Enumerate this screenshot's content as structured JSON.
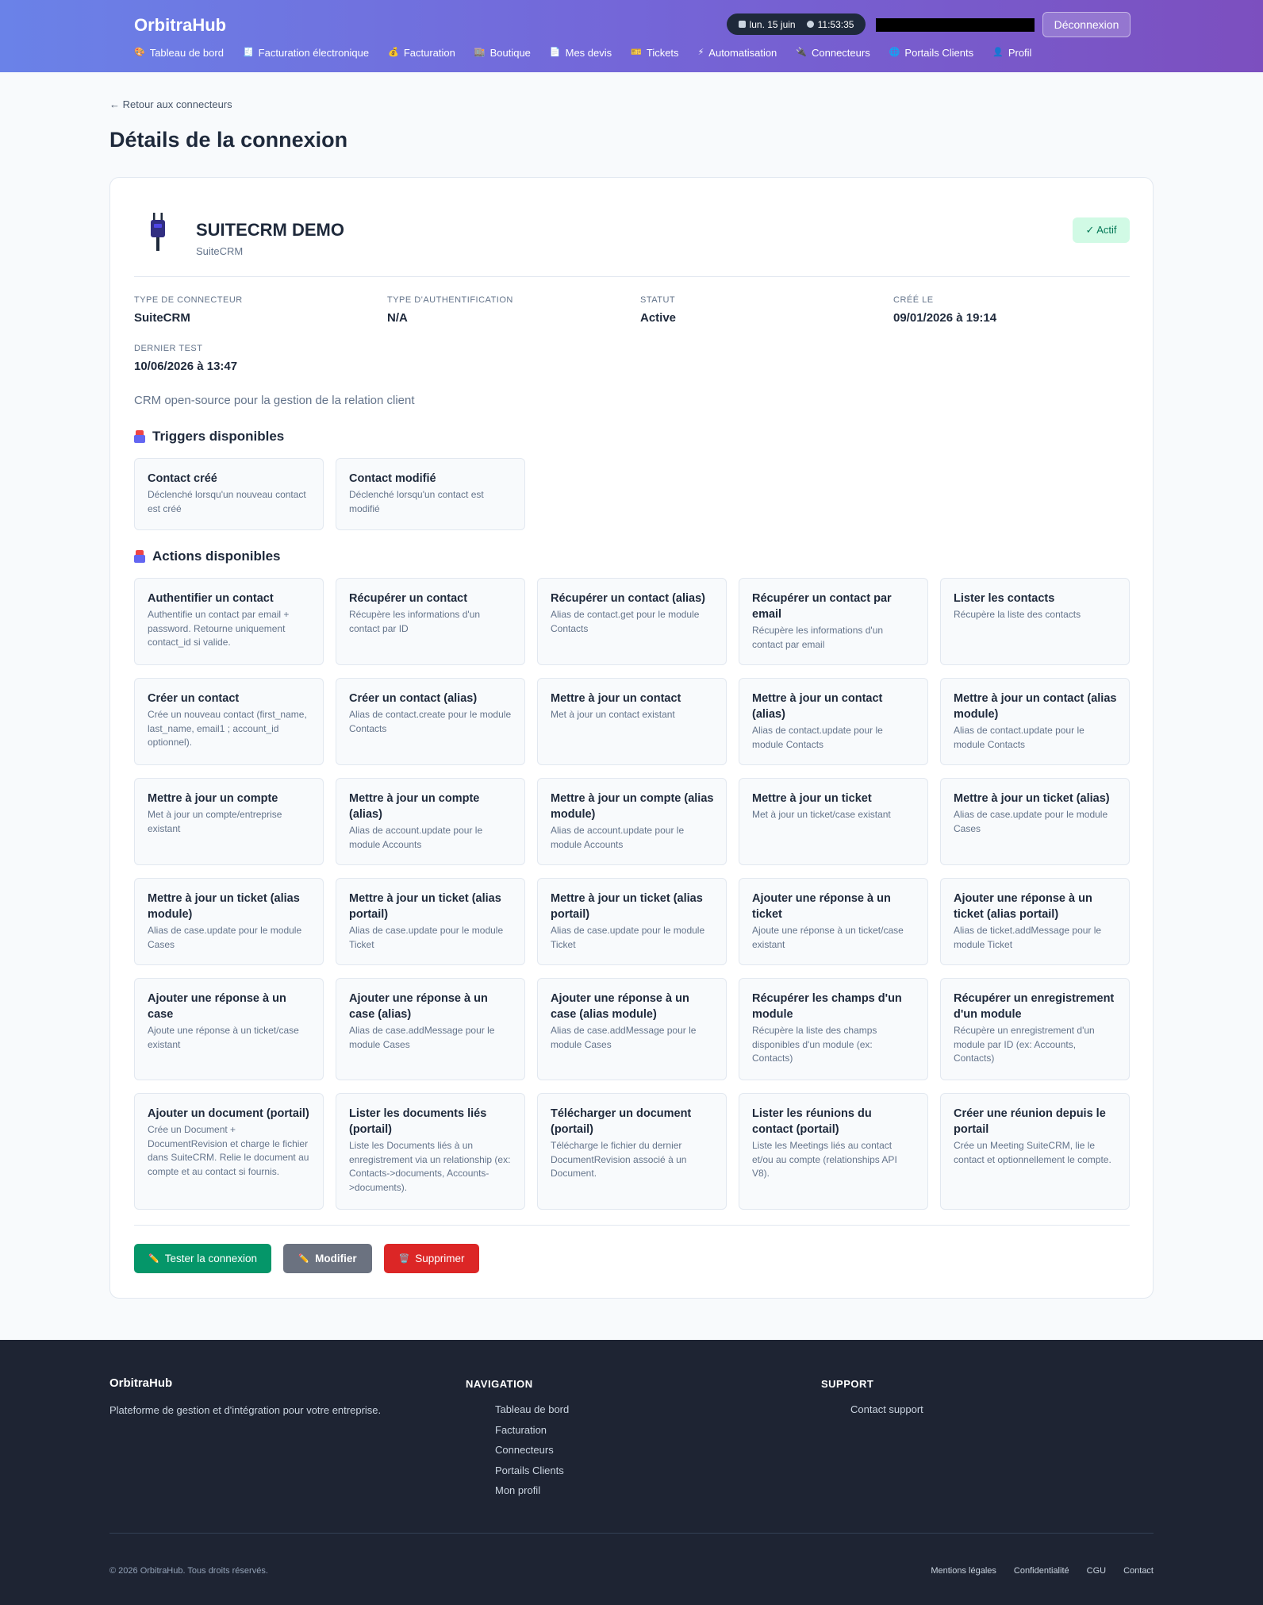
{
  "header": {
    "brand": "OrbitraHub",
    "date": "lun. 15 juin",
    "time": "11:53:35",
    "logout_label": "Déconnexion",
    "nav": [
      {
        "label": "Tableau de bord",
        "icon": "palette-icon"
      },
      {
        "label": "Facturation électronique",
        "icon": "document-icon"
      },
      {
        "label": "Facturation",
        "icon": "moneybag-icon"
      },
      {
        "label": "Boutique",
        "icon": "store-icon"
      },
      {
        "label": "Mes devis",
        "icon": "file-icon"
      },
      {
        "label": "Tickets",
        "icon": "ticket-icon"
      },
      {
        "label": "Automatisation",
        "icon": "bolt-icon"
      },
      {
        "label": "Connecteurs",
        "icon": "plug-icon"
      },
      {
        "label": "Portails Clients",
        "icon": "globe-icon"
      },
      {
        "label": "Profil",
        "icon": "user-icon"
      }
    ]
  },
  "page": {
    "back_label": "← Retour aux connecteurs",
    "title": "Détails de la connexion"
  },
  "connection": {
    "name": "SUITECRM DEMO",
    "subtitle": "SuiteCRM",
    "status_badge": "✓ Actif",
    "meta": [
      {
        "label": "Type de connecteur",
        "value": "SuiteCRM"
      },
      {
        "label": "Type d'authentification",
        "value": "N/A"
      },
      {
        "label": "Statut",
        "value": "Active"
      },
      {
        "label": "Créé le",
        "value": "09/01/2026 à 19:14"
      },
      {
        "label": "Dernier test",
        "value": "10/06/2026 à 13:47"
      }
    ],
    "description": "CRM open-source pour la gestion de la relation client"
  },
  "triggers": {
    "title": "Triggers disponibles",
    "items": [
      {
        "name": "Contact créé",
        "desc": "Déclenché lorsqu'un nouveau contact est créé"
      },
      {
        "name": "Contact modifié",
        "desc": "Déclenché lorsqu'un contact est modifié"
      }
    ]
  },
  "actions": {
    "title": "Actions disponibles",
    "items": [
      {
        "name": "Authentifier un contact",
        "desc": "Authentifie un contact par email + password. Retourne uniquement contact_id si valide."
      },
      {
        "name": "Récupérer un contact",
        "desc": "Récupère les informations d'un contact par ID"
      },
      {
        "name": "Récupérer un contact (alias)",
        "desc": "Alias de contact.get pour le module Contacts"
      },
      {
        "name": "Récupérer un contact par email",
        "desc": "Récupère les informations d'un contact par email"
      },
      {
        "name": "Lister les contacts",
        "desc": "Récupère la liste des contacts"
      },
      {
        "name": "Créer un contact",
        "desc": "Crée un nouveau contact (first_name, last_name, email1 ; account_id optionnel)."
      },
      {
        "name": "Créer un contact (alias)",
        "desc": "Alias de contact.create pour le module Contacts"
      },
      {
        "name": "Mettre à jour un contact",
        "desc": "Met à jour un contact existant"
      },
      {
        "name": "Mettre à jour un contact (alias)",
        "desc": "Alias de contact.update pour le module Contacts"
      },
      {
        "name": "Mettre à jour un contact (alias module)",
        "desc": "Alias de contact.update pour le module Contacts"
      },
      {
        "name": "Mettre à jour un compte",
        "desc": "Met à jour un compte/entreprise existant"
      },
      {
        "name": "Mettre à jour un compte (alias)",
        "desc": "Alias de account.update pour le module Accounts"
      },
      {
        "name": "Mettre à jour un compte (alias module)",
        "desc": "Alias de account.update pour le module Accounts"
      },
      {
        "name": "Mettre à jour un ticket",
        "desc": "Met à jour un ticket/case existant"
      },
      {
        "name": "Mettre à jour un ticket (alias)",
        "desc": "Alias de case.update pour le module Cases"
      },
      {
        "name": "Mettre à jour un ticket (alias module)",
        "desc": "Alias de case.update pour le module Cases"
      },
      {
        "name": "Mettre à jour un ticket (alias portail)",
        "desc": "Alias de case.update pour le module Ticket"
      },
      {
        "name": "Mettre à jour un ticket (alias portail)",
        "desc": "Alias de case.update pour le module Ticket"
      },
      {
        "name": "Ajouter une réponse à un ticket",
        "desc": "Ajoute une réponse à un ticket/case existant"
      },
      {
        "name": "Ajouter une réponse à un ticket (alias portail)",
        "desc": "Alias de ticket.addMessage pour le module Ticket"
      },
      {
        "name": "Ajouter une réponse à un case",
        "desc": "Ajoute une réponse à un ticket/case existant"
      },
      {
        "name": "Ajouter une réponse à un case (alias)",
        "desc": "Alias de case.addMessage pour le module Cases"
      },
      {
        "name": "Ajouter une réponse à un case (alias module)",
        "desc": "Alias de case.addMessage pour le module Cases"
      },
      {
        "name": "Récupérer les champs d'un module",
        "desc": "Récupère la liste des champs disponibles d'un module (ex: Contacts)"
      },
      {
        "name": "Récupérer un enregistrement d'un module",
        "desc": "Récupère un enregistrement d'un module par ID (ex: Accounts, Contacts)"
      },
      {
        "name": "Ajouter un document (portail)",
        "desc": "Crée un Document + DocumentRevision et charge le fichier dans SuiteCRM. Relie le document au compte et au contact si fournis."
      },
      {
        "name": "Lister les documents liés (portail)",
        "desc": "Liste les Documents liés à un enregistrement via un relationship (ex: Contacts->documents, Accounts->documents)."
      },
      {
        "name": "Télécharger un document (portail)",
        "desc": "Télécharge le fichier du dernier DocumentRevision associé à un Document."
      },
      {
        "name": "Lister les réunions du contact (portail)",
        "desc": "Liste les Meetings liés au contact et/ou au compte (relationships API V8)."
      },
      {
        "name": "Créer une réunion depuis le portail",
        "desc": "Crée un Meeting SuiteCRM, lie le contact et optionnellement le compte."
      }
    ]
  },
  "buttons": {
    "test": "Tester la connexion",
    "edit": "Modifier",
    "delete": "Supprimer"
  },
  "footer": {
    "brand": "OrbitraHub",
    "tagline": "Plateforme de gestion et d'intégration pour votre entreprise.",
    "nav_title": "NAVIGATION",
    "nav_links": [
      "Tableau de bord",
      "Facturation",
      "Connecteurs",
      "Portails Clients",
      "Mon profil"
    ],
    "support_title": "SUPPORT",
    "support_links": [
      "Contact support"
    ],
    "copyright": "© 2026 OrbitraHub. Tous droits réservés.",
    "legal": [
      "Mentions légales",
      "Confidentialité",
      "CGU",
      "Contact"
    ]
  },
  "colors": {
    "header_gradient": [
      "#6a82e8",
      "#7c4fbf"
    ],
    "success": "#059669",
    "danger": "#dc2626",
    "neutral": "#6b7280",
    "badge_bg": "#d1fae5"
  }
}
